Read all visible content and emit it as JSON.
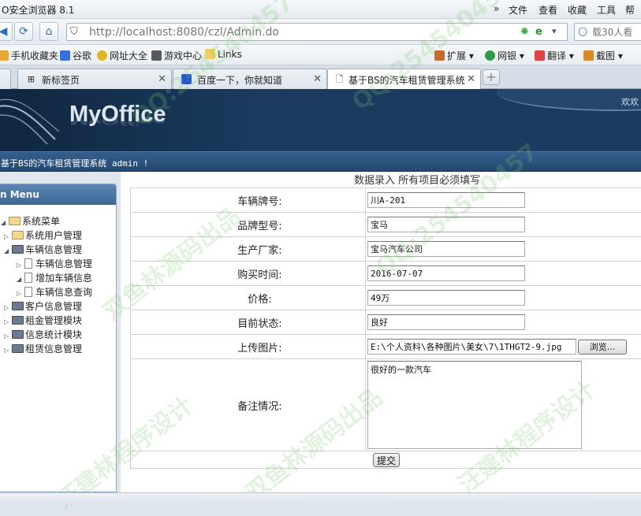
{
  "browser": {
    "title": "O安全浏览器 8.1",
    "menu": [
      "»",
      "文件",
      "查看",
      "收藏",
      "工具",
      "帮助"
    ],
    "url_value": "http://localhost:8080/czl/Admin.do",
    "search_placeholder": "载30人看",
    "bookmarks": [
      "手机收藏夹",
      "谷歌",
      "网址大全",
      "游戏中心",
      "Links"
    ],
    "ext_items": [
      "扩展",
      "网银",
      "翻译",
      "截图"
    ],
    "tabs": [
      {
        "label": "新标签页"
      },
      {
        "label": "百度一下，你就知道"
      },
      {
        "label": "基于BS的汽车租赁管理系统"
      }
    ]
  },
  "header": {
    "logo": "MyOffice",
    "user_link": "欢欢"
  },
  "welcome": "基于BS的汽车租赁管理系统 admin !",
  "sidebar": {
    "title": "n Menu",
    "root": "系统菜单",
    "items": [
      {
        "label": "系统用户管理"
      },
      {
        "label": "车辆信息管理"
      },
      {
        "label": "车辆信息管理"
      },
      {
        "label": "增加车辆信息"
      },
      {
        "label": "车辆信息查询"
      },
      {
        "label": "客户信息管理"
      },
      {
        "label": "租金管理模块"
      },
      {
        "label": "信息统计模块"
      },
      {
        "label": "租赁信息管理"
      }
    ]
  },
  "form": {
    "caption": "数据录入 所有项目必须填写",
    "fields": [
      {
        "label": "车辆牌号:",
        "value": "川A-201"
      },
      {
        "label": "品牌型号:",
        "value": "宝马"
      },
      {
        "label": "生产厂家:",
        "value": "宝马汽车公司"
      },
      {
        "label": "购买时间:",
        "value": "2016-07-07"
      },
      {
        "label": "价格:",
        "value": "49万"
      },
      {
        "label": "目前状态:",
        "value": "良好"
      }
    ],
    "upload_label": "上传图片:",
    "upload_value": "E:\\个人资料\\各种图片\\美女\\7\\1THGT2-9.jpg",
    "browse_label": "浏览...",
    "remarks_label": "备注情况:",
    "remarks_value": "很好的一款汽车",
    "submit_label": "提交"
  },
  "watermark": [
    "QQ:254540457",
    "双鱼林源码出品",
    "汪建林程序设计"
  ]
}
